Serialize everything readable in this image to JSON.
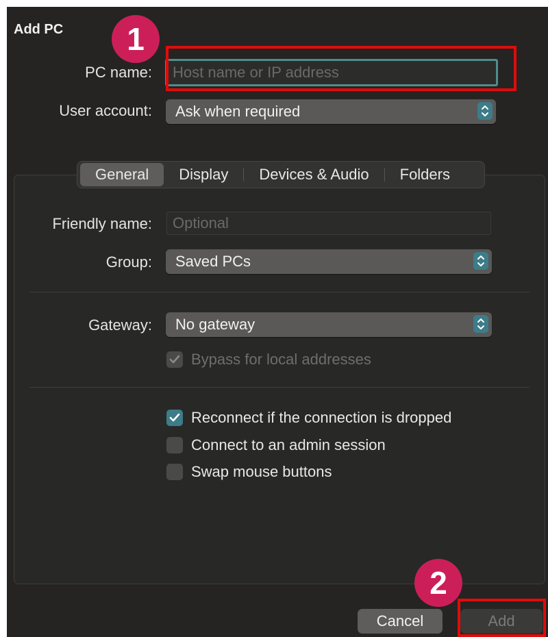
{
  "dialog": {
    "title": "Add PC"
  },
  "pc_name": {
    "label": "PC name:",
    "placeholder": "Host name or IP address",
    "value": ""
  },
  "user_account": {
    "label": "User account:",
    "selected": "Ask when required"
  },
  "tabs": [
    {
      "label": "General",
      "active": true
    },
    {
      "label": "Display",
      "active": false
    },
    {
      "label": "Devices & Audio",
      "active": false
    },
    {
      "label": "Folders",
      "active": false
    }
  ],
  "general": {
    "friendly_name": {
      "label": "Friendly name:",
      "placeholder": "Optional",
      "value": ""
    },
    "group": {
      "label": "Group:",
      "selected": "Saved PCs"
    },
    "gateway": {
      "label": "Gateway:",
      "selected": "No gateway"
    },
    "bypass_local": {
      "label": "Bypass for local addresses",
      "checked": true,
      "enabled": false
    },
    "reconnect": {
      "label": "Reconnect if the connection is dropped",
      "checked": true
    },
    "admin_session": {
      "label": "Connect to an admin session",
      "checked": false
    },
    "swap_mouse": {
      "label": "Swap mouse buttons",
      "checked": false
    }
  },
  "buttons": {
    "cancel": "Cancel",
    "add": "Add"
  },
  "annotations": {
    "step1": "1",
    "step2": "2"
  },
  "colors": {
    "background": "#252423",
    "accent": "#3d7c89",
    "focus_ring": "#4e8e8c",
    "highlight": "#e00b0b",
    "badge": "#cc1f5a"
  },
  "icons": {
    "popup_arrows": "up-down-chevron-icon",
    "checkmark": "checkmark-icon"
  }
}
